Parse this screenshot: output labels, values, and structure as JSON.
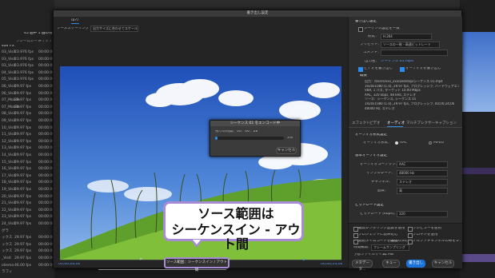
{
  "dialog": {
    "title": "書き出し設定",
    "top_tab": "出力",
    "source_scaling_label": "ソーススケーリング",
    "source_scaling_value": "出力サイズに合わせてスケール"
  },
  "project_panel": {
    "header_count": "45 個中 1 個の項目",
    "columns": [
      "フレームレート",
      "メディア"
    ],
    "folder": "ster FX",
    "rows": [
      {
        "name": "03_Visit",
        "fps": "23.976 fps",
        "tc": "00:00:00"
      },
      {
        "name": "03_Visit",
        "fps": "23.976 fps",
        "tc": "00:00:00"
      },
      {
        "name": "03_Visit",
        "fps": "23.976 fps",
        "tc": "00:00:00"
      },
      {
        "name": "04_Visit",
        "fps": "23.976 fps",
        "tc": "00:00:00"
      },
      {
        "name": "05_Visit",
        "fps": "23.976 fps",
        "tc": "00:00:00"
      },
      {
        "name": "06_Visit",
        "fps": "29.97 fps",
        "tc": "00:00:00"
      },
      {
        "name": "06_Visit",
        "fps": "29.97 fps",
        "tc": "00:00:00"
      },
      {
        "name": "07_Mobile",
        "fps": "29.97 fps",
        "tc": "00:00:00"
      },
      {
        "name": "07_Mobile",
        "fps": "29.97 fps",
        "tc": "00:00:00"
      },
      {
        "name": "08_Visit",
        "fps": "29.97 fps",
        "tc": "00:00:00"
      },
      {
        "name": "09_Visit",
        "fps": "29.97 fps",
        "tc": "00:00:00"
      },
      {
        "name": "10_Visit",
        "fps": "29.97 fps",
        "tc": "00:00:00"
      },
      {
        "name": "11_Visit",
        "fps": "29.97 fps",
        "tc": "00:00:00"
      },
      {
        "name": "12_Visit",
        "fps": "29.97 fps",
        "tc": "00:00:00"
      },
      {
        "name": "13_Visit",
        "fps": "29.97 fps",
        "tc": "00:00:00"
      },
      {
        "name": "14_Visit",
        "fps": "29.97 fps",
        "tc": "00:00:00"
      },
      {
        "name": "15_Visit",
        "fps": "29.97 fps",
        "tc": "00:00:00"
      },
      {
        "name": "16_Visit",
        "fps": "29.97 fps",
        "tc": "00:00:00"
      },
      {
        "name": "17_Visit",
        "fps": "29.97 fps",
        "tc": "00:00:00"
      },
      {
        "name": "18_Visit",
        "fps": "29.97 fps",
        "tc": "00:00:00"
      },
      {
        "name": "19_Visit",
        "fps": "29.97 fps",
        "tc": "00:00:00"
      },
      {
        "name": "20_Visit",
        "fps": "29.97 fps",
        "tc": "00:00:00"
      },
      {
        "name": "21_Visit",
        "fps": "29.97 fps",
        "tc": "00:00:00"
      },
      {
        "name": "22_Visit",
        "fps": "29.97 fps",
        "tc": "00:00:00"
      },
      {
        "name": "23_Visit",
        "fps": "29.97 fps",
        "tc": "00:00:00"
      },
      {
        "name": "24_Visit",
        "fps": "29.97 fps",
        "tc": "00:00:00"
      },
      {
        "name": "グラ",
        "fps": "",
        "tc": ""
      },
      {
        "name": "ックス",
        "fps": "29.97 fps",
        "tc": "00:00:00"
      },
      {
        "name": "ックス",
        "fps": "29.97 fps",
        "tc": "00:00:00"
      },
      {
        "name": "ックス",
        "fps": "29.97 fps",
        "tc": "00:00:00"
      },
      {
        "name": "_Visit",
        "fps": "29.97 fps",
        "tc": "00:00:00"
      },
      {
        "name": "oliema",
        "fps": "46.00 fps",
        "tc": "00:00:00"
      },
      {
        "name": "ラフィ",
        "fps": "",
        "tc": ""
      }
    ]
  },
  "export_settings": {
    "section_title": "書き出し設定",
    "match_sequence_label": "シーケンス設定を一致",
    "format_label": "形式：",
    "format_value": "H.264",
    "preset_label": "プリセット：",
    "preset_value": "ソースの一致 - 高速ビットレート",
    "comment_label": "コメント：",
    "output_name_label": "出力名：",
    "output_name_value": "シーケンス 01.mp4",
    "export_video_label": "ビデオを書き出し",
    "export_audio_label": "オーディオを書き出し",
    "summary_title": "概要",
    "summary_lines": [
      "出力：/Users/xxx_xxx/Desktop/シーケンス 01.mp4",
      "1920x1080 (1.0), 29.97 fps, プログレッシブ, ハードウェアエン...",
      "VBR, 1 パス, ターゲット 10.00 Mbps",
      "AAC, 320 kbps, 48 kHz, ステレオ",
      "ソース：シーケンス, シーケンス 01",
      "1920x1080 (1.0), 29.97 fps, プログレッシブ, 00;00;24;06",
      "48000 Hz, ステレオ"
    ]
  },
  "settings_tabs": [
    "エフェクト",
    "ビデオ",
    "オーディオ",
    "マルチプレクサー",
    "キャプション"
  ],
  "audio_settings": {
    "format_section": "オーディオ形式設定",
    "format_label": "オーディオ形式：",
    "format_aac": "AAC",
    "format_mpeg": "MPEG",
    "basic_section": "基本オーディオ設定",
    "codec_label": "オーディオコーデック：",
    "codec_value": "AAC",
    "sample_rate_label": "サンプルレート：",
    "sample_rate_value": "48000 Hz",
    "channels_label": "チャンネル：",
    "channels_value": "ステレオ",
    "quality_label": "品質：",
    "quality_value": "高",
    "bitrate_section": "ビットレート設定",
    "bitrate_label": "ビットレート [kbps]：",
    "bitrate_value": "320"
  },
  "bottom_options": {
    "max_render_quality": "最高レンダリング品質を使用",
    "use_previews": "プレビューを使用",
    "use_proxies": "プロキシを使用",
    "import_project": "プロジェクトに読み込む",
    "start_timecode": "開始タイムコードを設定",
    "start_timecode_value": "00;00;00;00",
    "alpha_only": "アルファチャンネルのみをレンダリング",
    "time_interpolation_label": "時間補間：",
    "time_interpolation_value": "フレームサンプリング",
    "file_size_label": "予想ファイルサイズ：",
    "file_size_value": "31 MB",
    "metadata_button": "メタデータ...",
    "queue_button": "キュー",
    "export_button": "書き出し",
    "cancel_button": "キャンセル"
  },
  "timeline": {
    "in_timecode": "00;00;00;00",
    "out_timecode": "00;00;24;06",
    "fit_label": "全体表示",
    "range_label_prefix": "ソース範囲：",
    "range_label_value": "シーケンスイン / アウト間"
  },
  "progress_dialog": {
    "title": "シーケンス 01 をエンコード中",
    "remaining": "残りの時間：00：00：28",
    "percent": "3%",
    "percent_value": 0.03,
    "cancel": "キャンセル"
  },
  "callout": {
    "line1": "ソース範囲は",
    "line2": "シーケンスイン - アウト間",
    "border_color": "#a78bd7"
  }
}
